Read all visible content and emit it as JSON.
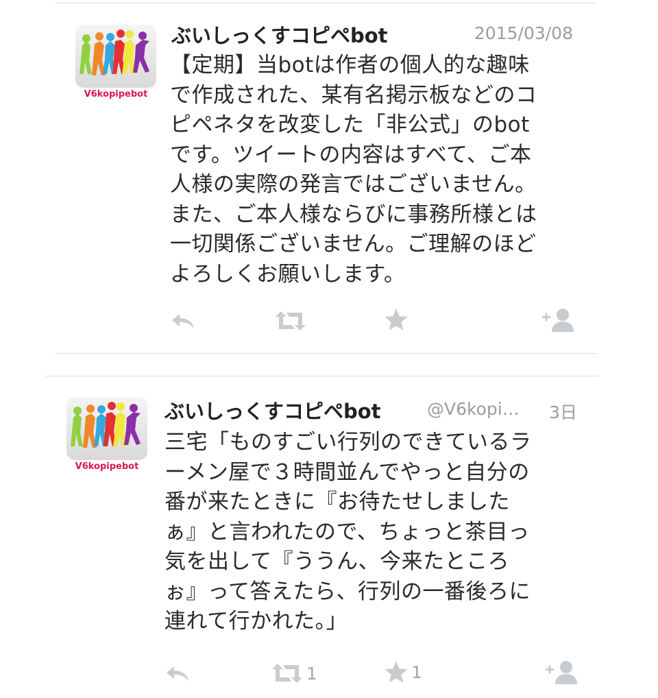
{
  "tweets": [
    {
      "name": "ぶいしっくすコピペbot",
      "handle": "",
      "time": "2015/03/08",
      "avatar_label": "V6kopipebot",
      "lines": [
        "【定期】当botは作者の個人的な趣味",
        "で作成された、某有名掲示板などのコ",
        "ピペネタを改変した「非公式」のbot",
        "です。ツイートの内容はすべて、ご本",
        "人様の実際の発言ではございません。",
        "また、ご本人様ならびに事務所様とは",
        "一切関係ございません。ご理解のほど",
        "よろしくお願いします。"
      ],
      "retweet_count": "",
      "favorite_count": ""
    },
    {
      "name": "ぶいしっくすコピペbot",
      "handle": "@V6kopi…",
      "time": "3日",
      "avatar_label": "V6kopipebot",
      "lines": [
        "三宅「ものすごい行列のできているラ",
        "ーメン屋で３時間並んでやっと自分の",
        "番が来たときに『お待たせしました",
        "ぁ』と言われたので、ちょっと茶目っ",
        "気を出して『ううん、今来たところ",
        "ぉ』って答えたら、行列の一番後ろに",
        "連れて行かれた。」"
      ],
      "retweet_count": "1",
      "favorite_count": "1"
    }
  ],
  "icons": {
    "reply": "reply-icon",
    "retweet": "retweet-icon",
    "favorite": "star-icon",
    "follow": "follow-icon"
  },
  "colors": {
    "icon_gray": "#c7ccd1",
    "text": "#2a2a2a",
    "meta": "#9c9c9c",
    "brand_pink": "#d8184b"
  }
}
